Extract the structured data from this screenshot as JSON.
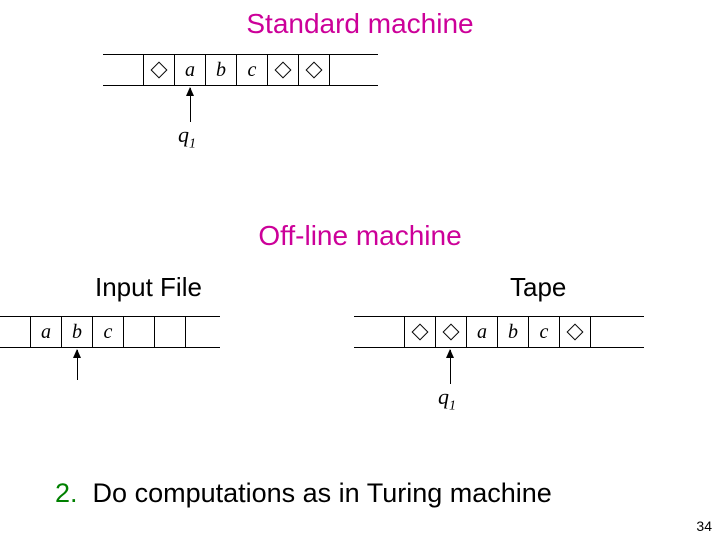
{
  "titles": {
    "standard": "Standard machine",
    "offline": "Off-line machine"
  },
  "labels": {
    "input_file": "Input File",
    "tape": "Tape"
  },
  "symbols": {
    "a": "a",
    "b": "b",
    "c": "c",
    "blank": "◇"
  },
  "state": {
    "q": "q",
    "sub": "1"
  },
  "step": {
    "num": "2.",
    "text": "Do computations as in Turing machine"
  },
  "page": "34",
  "chart_data": {
    "type": "table",
    "description": "Diagram comparing a standard Turing machine tape and an off-line machine with separate input file and tape.",
    "standard_tape": [
      "◇",
      "a",
      "b",
      "c",
      "◇",
      "◇"
    ],
    "standard_head_index": 1,
    "standard_state": "q1",
    "offline_input_file": [
      "a",
      "b",
      "c",
      "",
      ""
    ],
    "offline_input_head_index": 1,
    "offline_tape": [
      "◇",
      "◇",
      "a",
      "b",
      "c",
      "◇"
    ],
    "offline_tape_head_index": 1,
    "offline_tape_state": "q1",
    "instruction": "2. Do computations as in Turing machine"
  }
}
